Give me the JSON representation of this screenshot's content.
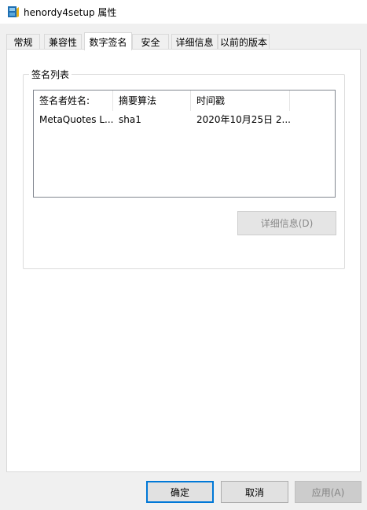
{
  "window": {
    "title": "henordy4setup 属性",
    "icon": "installer-app-icon"
  },
  "tabs": [
    {
      "label": "常规",
      "active": false
    },
    {
      "label": "兼容性",
      "active": false
    },
    {
      "label": "数字签名",
      "active": true
    },
    {
      "label": "安全",
      "active": false
    },
    {
      "label": "详细信息",
      "active": false
    },
    {
      "label": "以前的版本",
      "active": false
    }
  ],
  "signature_group": {
    "label": "签名列表",
    "columns": [
      "签名者姓名:",
      "摘要算法",
      "时间戳"
    ],
    "rows": [
      [
        "MetaQuotes L...",
        "sha1",
        "2020年10月25日 2..."
      ]
    ],
    "details_button": "详细信息(D)"
  },
  "footer": {
    "ok": "确定",
    "cancel": "取消",
    "apply": "应用(A)"
  },
  "colors": {
    "accent": "#0078d7",
    "window_bg": "#f0f0f0",
    "panel_bg": "#ffffff"
  }
}
